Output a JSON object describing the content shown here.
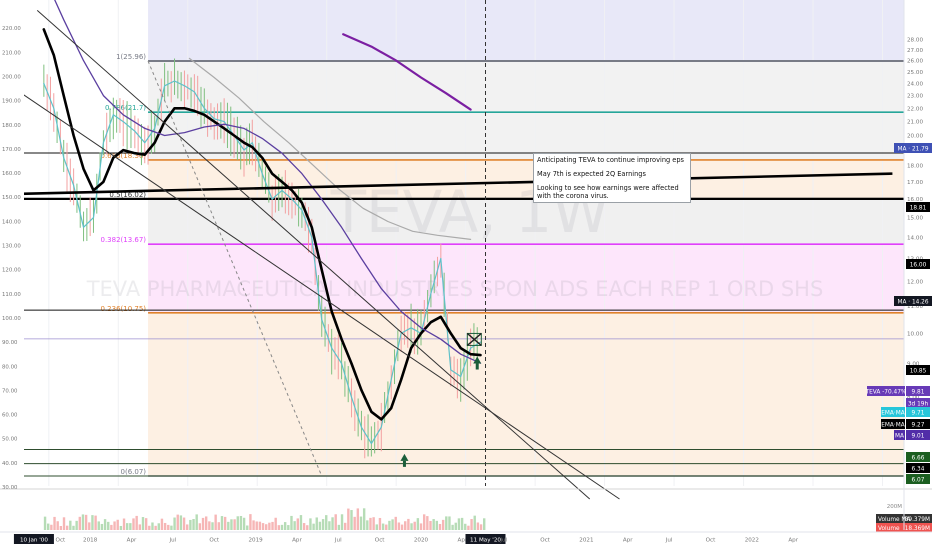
{
  "chart_data": {
    "type": "line",
    "symbol": "TEVA, 1W",
    "security_name": "TEVA PHARMACEUTICAL INDUSTRIES SPON ADS EACH REP 1 ORD SHS",
    "x_labels": [
      "10 Jan '00",
      "Oct",
      "2018",
      "Apr",
      "Jul",
      "Oct",
      "2019",
      "Apr",
      "Jul",
      "Oct",
      "2020",
      "Apr",
      "11 May '20",
      "Jul",
      "Oct",
      "2021",
      "Apr",
      "Jul",
      "Oct",
      "2022",
      "Apr"
    ],
    "left_axis": {
      "type": "percent",
      "range": [
        30,
        230
      ],
      "ticks": [
        "220.00",
        "210.00",
        "200.00",
        "190.00",
        "180.00",
        "170.00",
        "160.00",
        "150.00",
        "140.00",
        "130.00",
        "120.00",
        "110.00",
        "100.00",
        "90.00",
        "80.00",
        "70.00",
        "60.00",
        "50.00",
        "40.00",
        "30.00"
      ]
    },
    "right_axis": {
      "type": "log",
      "ticks": [
        "28.00",
        "27.00",
        "26.00",
        "25.00",
        "24.00",
        "23.00",
        "22.00",
        "21.00",
        "20.00",
        "19.00",
        "18.00",
        "17.00",
        "16.00",
        "15.00",
        "14.00",
        "13.00",
        "12.00",
        "11.00",
        "10.00",
        "9.00",
        "8.00",
        "7.00",
        "6.00"
      ]
    },
    "fib_levels": [
      {
        "label": "1(25.96)",
        "price": 25.96,
        "color": "#787b86"
      },
      {
        "label": "0.786(21.7)",
        "price": 21.7,
        "color": "#26a69a"
      },
      {
        "label": "0.618(18.36)",
        "price": 18.36,
        "color": "#e0822c"
      },
      {
        "label": "0.5(16.02)",
        "price": 16.02,
        "color": "#555555"
      },
      {
        "label": "0.382(13.67)",
        "price": 13.67,
        "color": "#e040fb"
      },
      {
        "label": "0.236(10.75)",
        "price": 10.75,
        "color": "#e0822c"
      },
      {
        "label": "0(6.07)",
        "price": 6.07,
        "color": "#787b86"
      }
    ],
    "horizontal_lines": [
      18.81,
      10.85,
      6.66,
      6.34,
      6.07
    ],
    "price_labels": [
      {
        "text": "MA · 21.79",
        "bg": "#3f51b5",
        "fg": "#ffffff"
      },
      {
        "text": "18.81",
        "bg": "#000000",
        "fg": "#ffffff"
      },
      {
        "text": "16.00",
        "bg": "#000000",
        "fg": "#ffffff"
      },
      {
        "text": "MA · 14.26",
        "bg": "#131722",
        "fg": "#ffffff"
      },
      {
        "text": "10.85",
        "bg": "#000000",
        "fg": "#ffffff"
      },
      {
        "text": "TEVA -70.47%",
        "bg": "#673ab7",
        "fg": "#ffffff"
      },
      {
        "text": "9.81",
        "bg": "#673ab7",
        "fg": "#ffffff"
      },
      {
        "text": "3d 19h",
        "bg": "#673ab7",
        "fg": "#ffffff"
      },
      {
        "text": "EMA·MA",
        "bg": "#26c6da",
        "fg": "#ffffff"
      },
      {
        "text": "9.71",
        "bg": "#26c6da",
        "fg": "#ffffff"
      },
      {
        "text": "EMA·MA",
        "bg": "#000000",
        "fg": "#ffffff"
      },
      {
        "text": "9.27",
        "bg": "#000000",
        "fg": "#ffffff"
      },
      {
        "text": "MA",
        "bg": "#512da8",
        "fg": "#ffffff"
      },
      {
        "text": "9.01",
        "bg": "#512da8",
        "fg": "#ffffff"
      },
      {
        "text": "6.66",
        "bg": "#1b5e20",
        "fg": "#ffffff"
      },
      {
        "text": "6.34",
        "bg": "#000000",
        "fg": "#ffffff"
      },
      {
        "text": "6.07",
        "bg": "#1b5e20",
        "fg": "#ffffff"
      }
    ],
    "volume_axis_labels": [
      "200M",
      "100M"
    ],
    "volume_labels": [
      {
        "text": "Volume MA",
        "value": "89.379M",
        "bg": "#333333"
      },
      {
        "text": "Volume",
        "value": "18.369M",
        "bg": "#ef5350"
      }
    ],
    "series": [
      {
        "name": "TEVA",
        "color": "#5fc1c9",
        "values": [
          [
            2017.72,
            24.0
          ],
          [
            2017.78,
            22.0
          ],
          [
            2017.84,
            18.5
          ],
          [
            2017.9,
            16.8
          ],
          [
            2017.96,
            14.5
          ],
          [
            2018.02,
            15.0
          ],
          [
            2018.08,
            19.5
          ],
          [
            2018.14,
            21.5
          ],
          [
            2018.2,
            21.0
          ],
          [
            2018.27,
            20.3
          ],
          [
            2018.33,
            19.5
          ],
          [
            2018.39,
            20.5
          ],
          [
            2018.45,
            23.8
          ],
          [
            2018.51,
            24.2
          ],
          [
            2018.57,
            23.8
          ],
          [
            2018.63,
            23.3
          ],
          [
            2018.69,
            22.0
          ],
          [
            2018.75,
            21.2
          ],
          [
            2018.81,
            21.0
          ],
          [
            2018.87,
            20.0
          ],
          [
            2018.93,
            19.0
          ],
          [
            2018.98,
            19.5
          ],
          [
            2019.04,
            17.5
          ],
          [
            2019.1,
            16.0
          ],
          [
            2019.16,
            16.5
          ],
          [
            2019.22,
            16.0
          ],
          [
            2019.28,
            15.4
          ],
          [
            2019.34,
            14.0
          ],
          [
            2019.4,
            10.5
          ],
          [
            2019.46,
            9.5
          ],
          [
            2019.52,
            9.0
          ],
          [
            2019.58,
            8.0
          ],
          [
            2019.64,
            7.2
          ],
          [
            2019.7,
            6.8
          ],
          [
            2019.76,
            7.2
          ],
          [
            2019.82,
            8.5
          ],
          [
            2019.88,
            10.0
          ],
          [
            2019.94,
            10.2
          ],
          [
            2020.0,
            10.0
          ],
          [
            2020.06,
            11.5
          ],
          [
            2020.12,
            13.0
          ],
          [
            2020.18,
            8.8
          ],
          [
            2020.24,
            8.6
          ],
          [
            2020.3,
            9.5
          ],
          [
            2020.36,
            9.7
          ]
        ]
      },
      {
        "name": "EMA·MA",
        "color": "#000000",
        "values": [
          [
            2017.72,
            29.0
          ],
          [
            2017.78,
            26.5
          ],
          [
            2017.84,
            23.0
          ],
          [
            2017.9,
            20.0
          ],
          [
            2017.96,
            17.8
          ],
          [
            2018.02,
            16.5
          ],
          [
            2018.08,
            17.0
          ],
          [
            2018.14,
            18.5
          ],
          [
            2018.2,
            19.0
          ],
          [
            2018.27,
            18.8
          ],
          [
            2018.33,
            18.7
          ],
          [
            2018.39,
            19.5
          ],
          [
            2018.45,
            21.0
          ],
          [
            2018.51,
            22.0
          ],
          [
            2018.57,
            22.0
          ],
          [
            2018.63,
            21.8
          ],
          [
            2018.69,
            21.5
          ],
          [
            2018.75,
            21.0
          ],
          [
            2018.81,
            20.5
          ],
          [
            2018.87,
            20.0
          ],
          [
            2018.93,
            19.5
          ],
          [
            2018.98,
            19.2
          ],
          [
            2019.04,
            18.5
          ],
          [
            2019.1,
            17.5
          ],
          [
            2019.16,
            17.0
          ],
          [
            2019.22,
            16.5
          ],
          [
            2019.28,
            15.8
          ],
          [
            2019.34,
            14.5
          ],
          [
            2019.4,
            12.5
          ],
          [
            2019.46,
            10.8
          ],
          [
            2019.52,
            9.8
          ],
          [
            2019.58,
            9.0
          ],
          [
            2019.64,
            8.2
          ],
          [
            2019.7,
            7.6
          ],
          [
            2019.76,
            7.4
          ],
          [
            2019.82,
            7.7
          ],
          [
            2019.88,
            8.5
          ],
          [
            2019.94,
            9.5
          ],
          [
            2020.0,
            10.0
          ],
          [
            2020.06,
            10.4
          ],
          [
            2020.12,
            10.6
          ],
          [
            2020.18,
            10.0
          ],
          [
            2020.24,
            9.5
          ],
          [
            2020.3,
            9.3
          ],
          [
            2020.36,
            9.27
          ]
        ]
      },
      {
        "name": "MA",
        "color": "#5b3fa0",
        "values": [
          [
            2017.72,
            35.0
          ],
          [
            2017.84,
            30.0
          ],
          [
            2017.96,
            26.0
          ],
          [
            2018.08,
            23.0
          ],
          [
            2018.2,
            21.5
          ],
          [
            2018.33,
            20.5
          ],
          [
            2018.45,
            20.0
          ],
          [
            2018.57,
            20.2
          ],
          [
            2018.69,
            20.6
          ],
          [
            2018.81,
            20.8
          ],
          [
            2018.93,
            20.5
          ],
          [
            2019.04,
            19.8
          ],
          [
            2019.16,
            18.8
          ],
          [
            2019.28,
            17.5
          ],
          [
            2019.4,
            16.0
          ],
          [
            2019.52,
            14.5
          ],
          [
            2019.64,
            13.0
          ],
          [
            2019.76,
            11.7
          ],
          [
            2019.88,
            10.8
          ],
          [
            2020.0,
            10.2
          ],
          [
            2020.12,
            9.8
          ],
          [
            2020.24,
            9.3
          ],
          [
            2020.36,
            9.01
          ]
        ]
      },
      {
        "name": "MA",
        "color": "#aaaaaa",
        "values": [
          [
            2018.6,
            26.2
          ],
          [
            2018.75,
            24.5
          ],
          [
            2018.9,
            22.8
          ],
          [
            2019.05,
            21.0
          ],
          [
            2019.2,
            19.5
          ],
          [
            2019.35,
            18.0
          ],
          [
            2019.5,
            16.6
          ],
          [
            2019.65,
            15.5
          ],
          [
            2019.8,
            14.8
          ],
          [
            2019.95,
            14.3
          ],
          [
            2020.1,
            14.1
          ],
          [
            2020.3,
            13.9
          ]
        ]
      },
      {
        "name": "MA",
        "color": "#7b1fa2",
        "values": [
          [
            2019.53,
            28.5
          ],
          [
            2019.7,
            27.3
          ],
          [
            2019.85,
            26.0
          ],
          [
            2020.0,
            24.5
          ],
          [
            2020.15,
            23.2
          ],
          [
            2020.3,
            21.9
          ]
        ]
      }
    ],
    "trend_lines": [
      {
        "from": [
          2017.55,
          16.3
        ],
        "to": [
          2022.85,
          17.5
        ],
        "color": "#000000"
      },
      {
        "from": [
          2017.68,
          31.0
        ],
        "to": [
          2021.02,
          5.6
        ],
        "color": "#333333"
      },
      {
        "from": [
          2017.55,
          23.5
        ],
        "to": [
          2021.2,
          5.6
        ],
        "color": "#333333"
      }
    ]
  },
  "annotation": {
    "lines": [
      "Anticipating TEVA to continue improving eps",
      "May 7th is expected 2Q Earnings",
      "Looking to see how earnings were affected with the corona virus."
    ]
  }
}
